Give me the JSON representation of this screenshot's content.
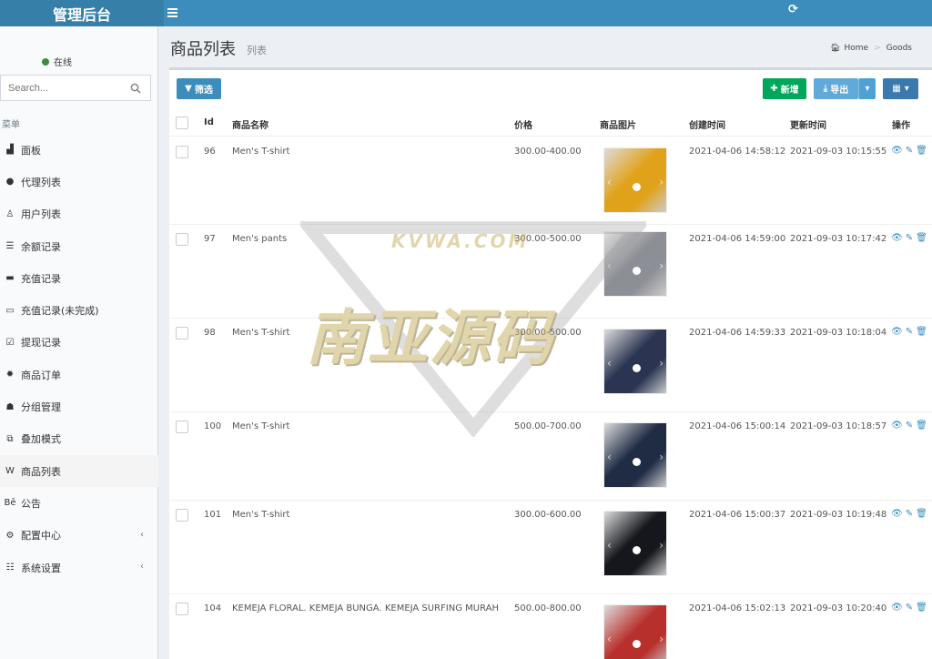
{
  "header": {
    "brand": "管理后台",
    "menu_icon": "bars-icon",
    "refresh_icon": "refresh-icon"
  },
  "sidebar": {
    "status": "在线",
    "search_placeholder": "Search...",
    "menu_header": "菜单",
    "items": [
      {
        "label": "面板",
        "icon": "area-chart-icon",
        "glyph": "▟"
      },
      {
        "label": "代理列表",
        "icon": "circle-icon",
        "glyph": "●"
      },
      {
        "label": "用户列表",
        "icon": "user-tie-icon",
        "glyph": "♙"
      },
      {
        "label": "余额记录",
        "icon": "list-icon",
        "glyph": "☰"
      },
      {
        "label": "充值记录",
        "icon": "credit-card-icon",
        "glyph": "▬"
      },
      {
        "label": "充值记录(未完成)",
        "icon": "credit-card-outline-icon",
        "glyph": "▭"
      },
      {
        "label": "提现记录",
        "icon": "check-square-icon",
        "glyph": "☑"
      },
      {
        "label": "商品订单",
        "icon": "gear-icon",
        "glyph": "✹"
      },
      {
        "label": "分组管理",
        "icon": "users-icon",
        "glyph": "☗"
      },
      {
        "label": "叠加模式",
        "icon": "object-group-icon",
        "glyph": "⧉"
      },
      {
        "label": "商品列表",
        "icon": "vimeo-icon",
        "glyph": "W"
      },
      {
        "label": "公告",
        "icon": "behance-icon",
        "glyph": "Bē"
      },
      {
        "label": "配置中心",
        "icon": "cog-icon",
        "glyph": "⚙",
        "chevron": "‹"
      },
      {
        "label": "系统设置",
        "icon": "list-alt-icon",
        "glyph": "☷",
        "chevron": "‹"
      }
    ]
  },
  "page": {
    "title": "商品列表",
    "subtitle": "列表"
  },
  "breadcrumb": {
    "home": "Home",
    "current": "Goods"
  },
  "toolbar": {
    "filter": "筛选",
    "add": "新增",
    "export": "导出"
  },
  "table": {
    "headers": {
      "id": "Id",
      "name": "商品名称",
      "price": "价格",
      "image": "商品图片",
      "created": "创建时间",
      "updated": "更新时间",
      "ops": "操作"
    },
    "rows": [
      {
        "id": "96",
        "name": "Men's T-shirt",
        "price": "300.00-400.00",
        "created": "2021-04-06 14:58:12",
        "updated": "2021-09-03 10:15:55",
        "image_color": "#e0a21a"
      },
      {
        "id": "97",
        "name": "Men's pants",
        "price": "300.00-500.00",
        "created": "2021-04-06 14:59:00",
        "updated": "2021-09-03 10:17:42",
        "image_color": "#8d8f96"
      },
      {
        "id": "98",
        "name": "Men's T-shirt",
        "price": "300.00-500.00",
        "created": "2021-04-06 14:59:33",
        "updated": "2021-09-03 10:18:04",
        "image_color": "#2b3552"
      },
      {
        "id": "100",
        "name": "Men's T-shirt",
        "price": "500.00-700.00",
        "created": "2021-04-06 15:00:14",
        "updated": "2021-09-03 10:18:57",
        "image_color": "#1f2c44"
      },
      {
        "id": "101",
        "name": "Men's T-shirt",
        "price": "300.00-600.00",
        "created": "2021-04-06 15:00:37",
        "updated": "2021-09-03 10:19:48",
        "image_color": "#15171c"
      },
      {
        "id": "104",
        "name": "KEMEJA FLORAL. KEMEJA BUNGA. KEMEJA SURFING MURAH",
        "price": "500.00-800.00",
        "created": "2021-04-06 15:02:13",
        "updated": "2021-09-03 10:20:40",
        "image_color": "#b8302c"
      }
    ]
  },
  "watermark": {
    "top": "KVWA.COM",
    "main": "南亚源码"
  }
}
